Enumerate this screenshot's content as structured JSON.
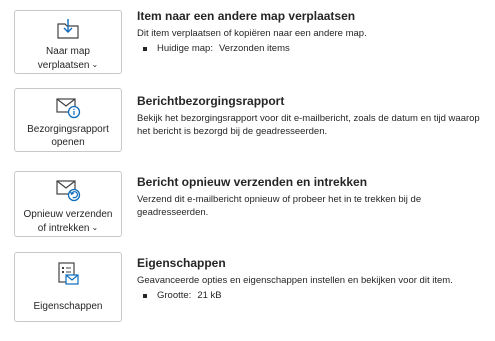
{
  "items": [
    {
      "button_lines": [
        "Naar map",
        "verplaatsen"
      ],
      "has_dropdown": true,
      "icon": "folder-move-icon",
      "title": "Item naar een andere map verplaatsen",
      "description": "Dit item verplaatsen of kopiëren naar een andere map.",
      "bullet_key": "Huidige map:",
      "bullet_value": "Verzonden items"
    },
    {
      "button_lines": [
        "Bezorgingsrapport",
        "openen"
      ],
      "has_dropdown": false,
      "icon": "mail-info-icon",
      "title": "Berichtbezorgingsrapport",
      "description": "Bekijk het bezorgingsrapport voor dit e-mailbericht, zoals de datum en tijd waarop het bericht is bezorgd bij de geadresseerden."
    },
    {
      "button_lines": [
        "Opnieuw verzenden",
        "of intrekken"
      ],
      "has_dropdown": true,
      "icon": "mail-resend-icon",
      "title": "Bericht opnieuw verzenden en intrekken",
      "description": "Verzend dit e-mailbericht opnieuw of probeer het in te trekken bij de geadresseerden."
    },
    {
      "button_lines": [
        "Eigenschappen"
      ],
      "has_dropdown": false,
      "icon": "properties-icon",
      "title": "Eigenschappen",
      "description": "Geavanceerde opties en eigenschappen instellen en bekijken voor dit item.",
      "bullet_key": "Grootte:",
      "bullet_value": "21 kB"
    }
  ],
  "colors": {
    "accent": "#0f6cbd",
    "icon_stroke": "#424242",
    "border": "#c8c8c8"
  }
}
